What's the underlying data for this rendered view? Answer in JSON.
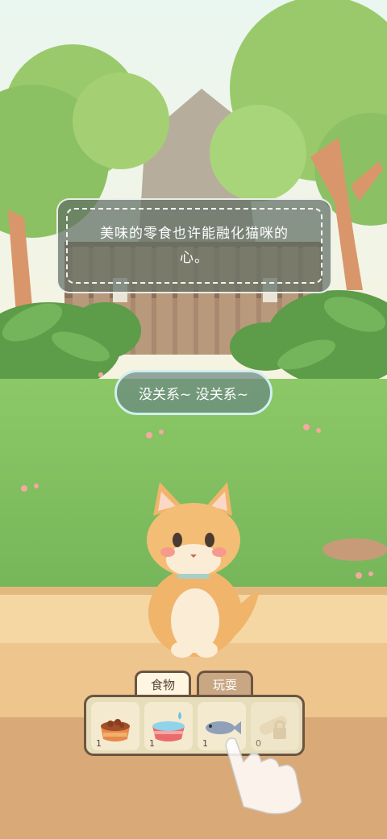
{
  "dialog": {
    "text": "美味的零食也许能融化猫咪的心。"
  },
  "reply": {
    "label": "没关系~ 没关系~"
  },
  "tabs": [
    {
      "label": "食物"
    },
    {
      "label": "玩耍"
    }
  ],
  "items": [
    {
      "name": "dry-food-bowl",
      "count": "1"
    },
    {
      "name": "water-bowl",
      "count": "1"
    },
    {
      "name": "fish",
      "count": "1"
    },
    {
      "name": "locked-item",
      "count": "0"
    }
  ],
  "colors": {
    "accent": "#6b5443",
    "grass": "#7bbf5a"
  }
}
